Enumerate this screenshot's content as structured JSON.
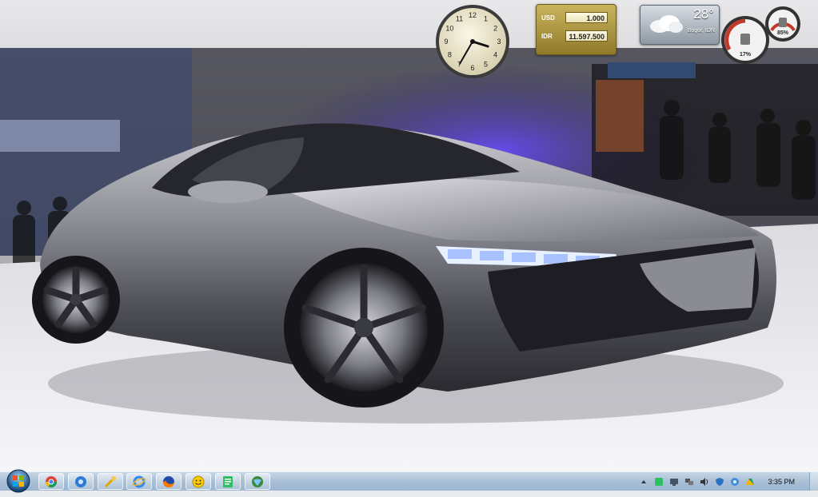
{
  "desktop": {
    "wallpaper": "silver sports car on auto show stage"
  },
  "gadgets": {
    "clock": {
      "numbers": [
        "12",
        "1",
        "2",
        "3",
        "4",
        "5",
        "6",
        "7",
        "8",
        "9",
        "10",
        "11"
      ],
      "hour": 3,
      "minute": 35
    },
    "currency": {
      "row1": {
        "code": "USD",
        "value": "1.000"
      },
      "row2": {
        "code": "IDR",
        "value": "11.597.500"
      }
    },
    "weather": {
      "temperature": "28°",
      "location": "Bogor, IDN"
    },
    "meters": {
      "cpu": "17%",
      "memory": "85%"
    }
  },
  "taskbar": {
    "apps": [
      {
        "name": "Chrome"
      },
      {
        "name": "Settings"
      },
      {
        "name": "Tools"
      },
      {
        "name": "Internet Explorer"
      },
      {
        "name": "Firefox"
      },
      {
        "name": "Messenger"
      },
      {
        "name": "Evernote"
      },
      {
        "name": "Network"
      }
    ],
    "tray": {
      "time": "3:35 PM"
    }
  },
  "colors": {
    "taskbar": "#a8bfd6",
    "currency_gold": "#b39d45",
    "weather_blue": "#8e98a3",
    "meter_red": "#c0392b"
  }
}
